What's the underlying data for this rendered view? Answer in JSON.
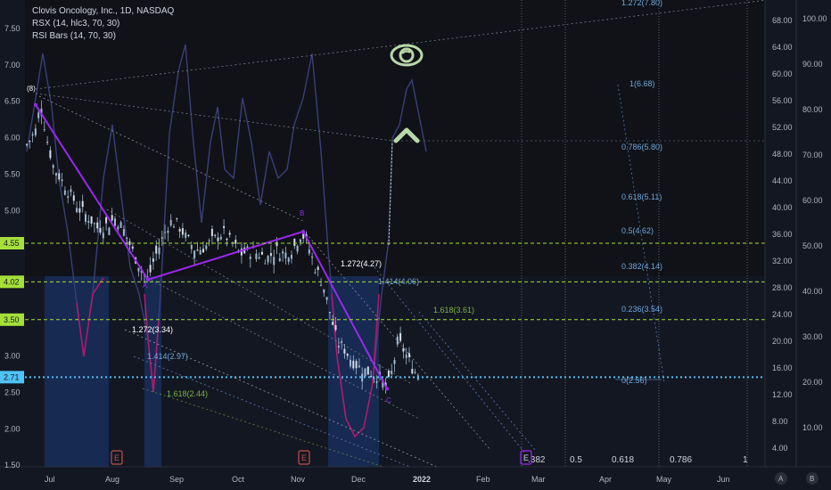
{
  "header": {
    "symbol_line": "Clovis Oncology, Inc., 1D, NASDAQ",
    "indicator1": "RSX (14, hlc3, 70, 30)",
    "indicator2": "RSI Bars (14, 70, 30)"
  },
  "colors": {
    "background": "#131722",
    "candle": "#9fb8d0",
    "wave": "#9c27f0",
    "rsx": "#3a3f7a",
    "rsx_low": "#b01a6a",
    "level_green": "#a5e03a",
    "current_price": "#4fc3f7",
    "oversold_zone": "#1c3a7a",
    "fib": "#6fa8dc"
  },
  "icons": {
    "eye": "eye-icon",
    "up_arrow": "chevron-up-icon",
    "earnings": "earnings-badge-icon"
  },
  "axis_buttons": {
    "a": "A",
    "b": "B"
  },
  "chart_data": {
    "type": "candlestick",
    "left_axis": {
      "ticks": [
        "7.50",
        "7.00",
        "6.50",
        "6.00",
        "5.50",
        "5.00",
        "4.50",
        "4.00",
        "3.50",
        "3.00",
        "2.50",
        "2.00",
        "1.50"
      ],
      "range": [
        1.5,
        7.5
      ]
    },
    "price_labels": [
      {
        "value": 4.55,
        "label": "4.55"
      },
      {
        "value": 4.02,
        "label": "4.02"
      },
      {
        "value": 3.5,
        "label": "3.50"
      },
      {
        "value": 2.71,
        "label": "2.71"
      }
    ],
    "right_axis_inner": [
      "68.00",
      "64.00",
      "60.00",
      "56.00",
      "52.00",
      "48.00",
      "44.00",
      "40.00",
      "36.00",
      "32.00",
      "28.00",
      "24.00",
      "20.00",
      "16.00",
      "12.00",
      "8.00",
      "4.00"
    ],
    "right_axis_outer": [
      "100.00",
      "90.00",
      "80.00",
      "70.00",
      "60.00",
      "50.00",
      "40.00",
      "30.00",
      "20.00",
      "10.00"
    ],
    "x_axis": [
      "Jul",
      "Aug",
      "Sep",
      "Oct",
      "Nov",
      "Dec",
      "2022",
      "Feb",
      "Mar",
      "Apr",
      "May",
      "Jun"
    ],
    "wave_points": [
      {
        "label": "A",
        "price": 4.05
      },
      {
        "label": "B",
        "price": 4.71
      },
      {
        "label": "C",
        "price": 2.55
      }
    ],
    "pivot_label": "(8)",
    "fib_extension_labels": [
      {
        "label": "1.272(3.34)",
        "price": 3.34
      },
      {
        "label": "1.414(2.97)",
        "price": 2.97
      },
      {
        "label": "1.618(2.44)",
        "price": 2.44
      },
      {
        "label": "1.272(4.27)",
        "price": 4.27
      },
      {
        "label": "1.414(4.06)",
        "price": 4.06
      },
      {
        "label": "1.618(3.61)",
        "price": 3.61
      }
    ],
    "fib_retracement_labels": [
      "1.272(7.80)",
      "1(6.68)",
      "0.786(5.80)",
      "0.618(5.11)",
      "0.5(4.62)",
      "0.382(4.14)",
      "0.236(3.54)",
      "0(2.56)"
    ],
    "time_fib_labels": [
      ".382",
      "0.5",
      "0.618",
      "0.786",
      "1"
    ]
  }
}
